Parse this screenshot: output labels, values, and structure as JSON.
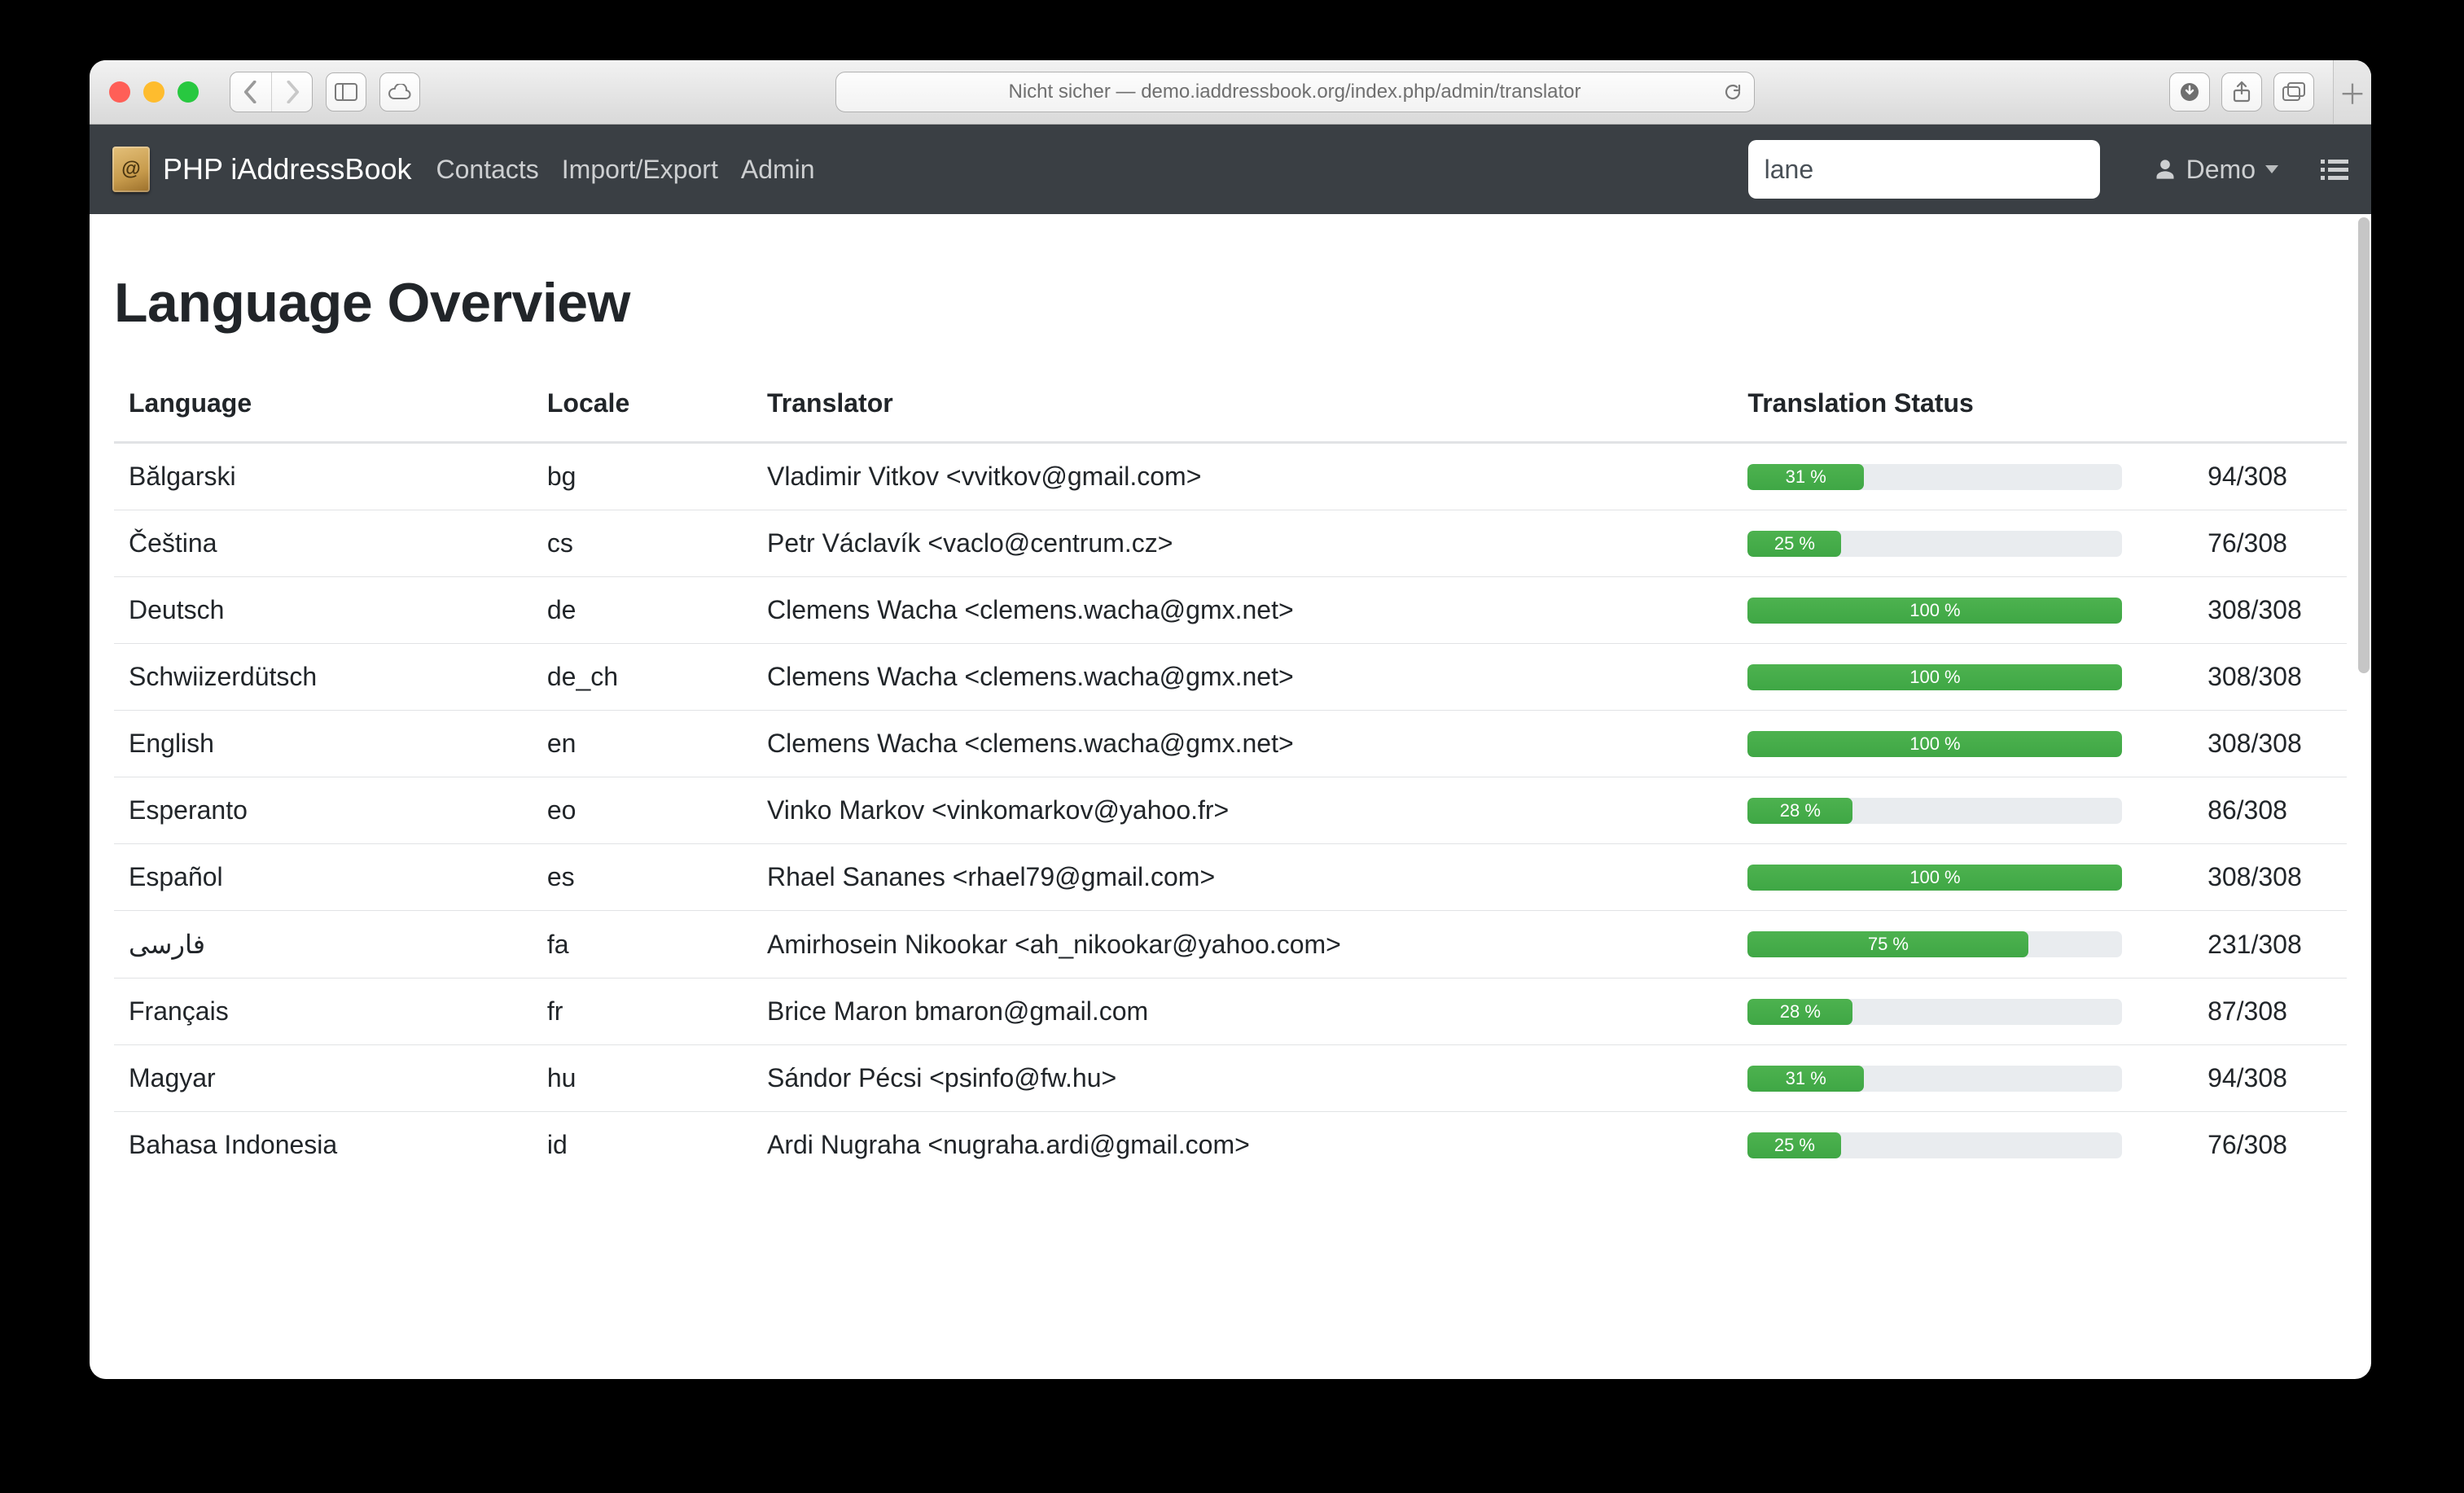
{
  "browser": {
    "address_text": "Nicht sicher — demo.iaddressbook.org/index.php/admin/translator"
  },
  "navbar": {
    "brand": "PHP iAddressBook",
    "links": {
      "contacts": "Contacts",
      "import_export": "Import/Export",
      "admin": "Admin"
    },
    "search_value": "lane",
    "user_label": "Demo"
  },
  "page": {
    "title": "Language Overview",
    "columns": {
      "language": "Language",
      "locale": "Locale",
      "translator": "Translator",
      "status": "Translation Status"
    }
  },
  "rows": [
    {
      "language": "Bălgarski",
      "locale": "bg",
      "translator": "Vladimir Vitkov <vvitkov@gmail.com>",
      "pct": 31,
      "done": 94,
      "total": 308
    },
    {
      "language": "Čeština",
      "locale": "cs",
      "translator": "Petr Václavík <vaclo@centrum.cz>",
      "pct": 25,
      "done": 76,
      "total": 308
    },
    {
      "language": "Deutsch",
      "locale": "de",
      "translator": "Clemens Wacha <clemens.wacha@gmx.net>",
      "pct": 100,
      "done": 308,
      "total": 308
    },
    {
      "language": "Schwiizerdütsch",
      "locale": "de_ch",
      "translator": "Clemens Wacha <clemens.wacha@gmx.net>",
      "pct": 100,
      "done": 308,
      "total": 308
    },
    {
      "language": "English",
      "locale": "en",
      "translator": "Clemens Wacha <clemens.wacha@gmx.net>",
      "pct": 100,
      "done": 308,
      "total": 308
    },
    {
      "language": "Esperanto",
      "locale": "eo",
      "translator": "Vinko Markov <vinkomarkov@yahoo.fr>",
      "pct": 28,
      "done": 86,
      "total": 308
    },
    {
      "language": "Español",
      "locale": "es",
      "translator": "Rhael Sananes <rhael79@gmail.com>",
      "pct": 100,
      "done": 308,
      "total": 308
    },
    {
      "language": "فارسی",
      "locale": "fa",
      "translator": "Amirhosein Nikookar <ah_nikookar@yahoo.com>",
      "pct": 75,
      "done": 231,
      "total": 308
    },
    {
      "language": "Français",
      "locale": "fr",
      "translator": "Brice Maron bmaron@gmail.com",
      "pct": 28,
      "done": 87,
      "total": 308
    },
    {
      "language": "Magyar",
      "locale": "hu",
      "translator": "Sándor Pécsi <psinfo@fw.hu>",
      "pct": 31,
      "done": 94,
      "total": 308
    },
    {
      "language": "Bahasa Indonesia",
      "locale": "id",
      "translator": "Ardi Nugraha <nugraha.ardi@gmail.com>",
      "pct": 25,
      "done": 76,
      "total": 308
    }
  ]
}
